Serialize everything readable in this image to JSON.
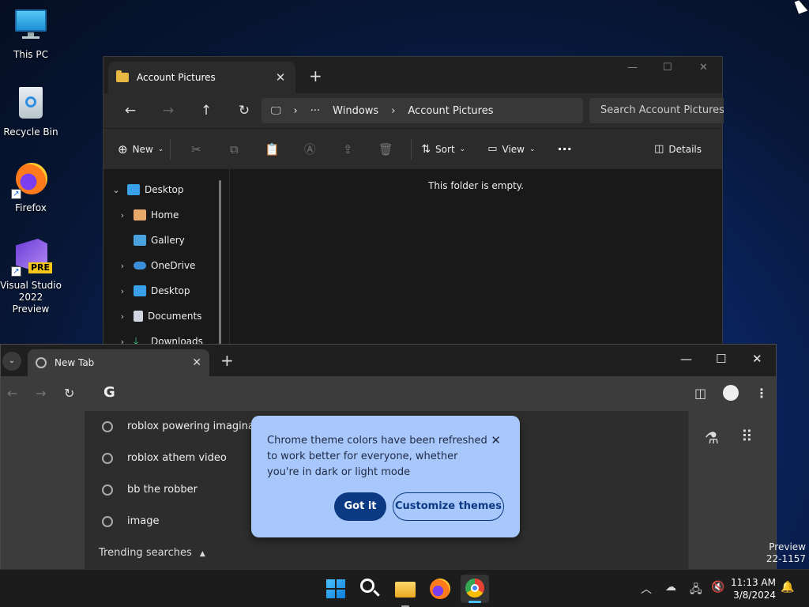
{
  "desktop": {
    "icons": [
      {
        "label": "This PC"
      },
      {
        "label": "Recycle Bin"
      },
      {
        "label": "Firefox"
      },
      {
        "label": "Visual Studio 2022 Preview",
        "badge": "PRE"
      }
    ]
  },
  "explorer": {
    "tab_title": "Account Pictures",
    "breadcrumb": [
      "Windows",
      "Account Pictures"
    ],
    "search_placeholder": "Search Account Pictures",
    "toolbar": {
      "new": "New",
      "sort": "Sort",
      "view": "View",
      "details": "Details"
    },
    "tree": [
      {
        "label": "Desktop",
        "color": "#3aa0e8"
      },
      {
        "label": "Home",
        "color": "#e7a96b"
      },
      {
        "label": "Gallery",
        "color": "#4aa3df"
      },
      {
        "label": "OneDrive",
        "color": "#3b8fd9"
      },
      {
        "label": "Desktop",
        "color": "#3aa0e8"
      },
      {
        "label": "Documents",
        "color": "#cfd6df"
      },
      {
        "label": "Downloads",
        "color": "#3fbf7f"
      }
    ],
    "empty_message": "This folder is empty."
  },
  "chrome": {
    "tab_title": "New Tab",
    "suggestions": [
      "roblox powering imagina",
      "roblox athem video",
      "bb the robber",
      "image"
    ],
    "trending_label": "Trending searches",
    "popup": {
      "message": "Chrome theme colors have been refreshed to work better for everyone, whether you're in dark or light mode",
      "got_it": "Got it",
      "customize": "Customize themes"
    }
  },
  "watermark": {
    "line1": "Preview",
    "line2": "22-1157"
  },
  "taskbar": {
    "time": "11:13 AM",
    "date": "3/8/2024"
  }
}
